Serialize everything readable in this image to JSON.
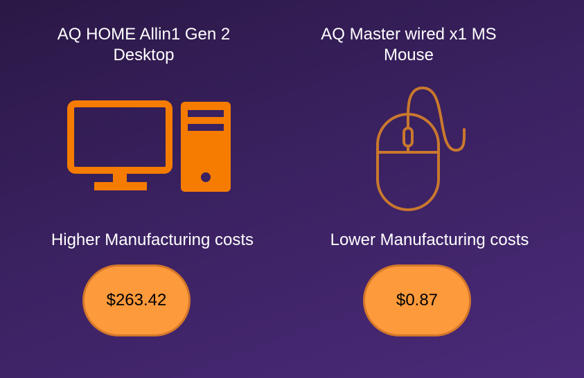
{
  "products": [
    {
      "title": "AQ HOME Allin1 Gen 2 Desktop",
      "icon": "desktop-computer-icon",
      "caption": "Higher Manufacturing costs",
      "price": "$263.42"
    },
    {
      "title": "AQ Master wired x1 MS Mouse",
      "icon": "computer-mouse-icon",
      "caption": "Lower Manufacturing costs",
      "price": "$0.87"
    }
  ],
  "colors": {
    "accent": "#f57c00",
    "price_fill": "#fd9a3c",
    "price_border": "#d4772a",
    "mouse_stroke": "#c9782e"
  }
}
